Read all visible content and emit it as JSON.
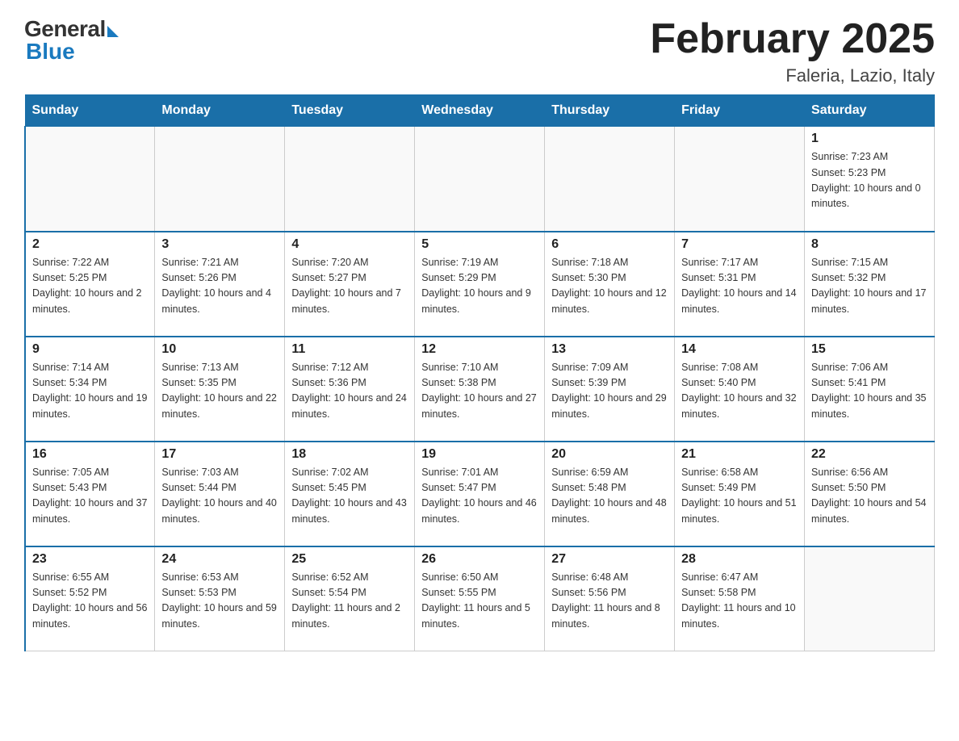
{
  "logo": {
    "general": "General",
    "blue": "Blue"
  },
  "header": {
    "title": "February 2025",
    "location": "Faleria, Lazio, Italy"
  },
  "weekdays": [
    "Sunday",
    "Monday",
    "Tuesday",
    "Wednesday",
    "Thursday",
    "Friday",
    "Saturday"
  ],
  "weeks": [
    [
      {
        "day": "",
        "info": ""
      },
      {
        "day": "",
        "info": ""
      },
      {
        "day": "",
        "info": ""
      },
      {
        "day": "",
        "info": ""
      },
      {
        "day": "",
        "info": ""
      },
      {
        "day": "",
        "info": ""
      },
      {
        "day": "1",
        "info": "Sunrise: 7:23 AM\nSunset: 5:23 PM\nDaylight: 10 hours and 0 minutes."
      }
    ],
    [
      {
        "day": "2",
        "info": "Sunrise: 7:22 AM\nSunset: 5:25 PM\nDaylight: 10 hours and 2 minutes."
      },
      {
        "day": "3",
        "info": "Sunrise: 7:21 AM\nSunset: 5:26 PM\nDaylight: 10 hours and 4 minutes."
      },
      {
        "day": "4",
        "info": "Sunrise: 7:20 AM\nSunset: 5:27 PM\nDaylight: 10 hours and 7 minutes."
      },
      {
        "day": "5",
        "info": "Sunrise: 7:19 AM\nSunset: 5:29 PM\nDaylight: 10 hours and 9 minutes."
      },
      {
        "day": "6",
        "info": "Sunrise: 7:18 AM\nSunset: 5:30 PM\nDaylight: 10 hours and 12 minutes."
      },
      {
        "day": "7",
        "info": "Sunrise: 7:17 AM\nSunset: 5:31 PM\nDaylight: 10 hours and 14 minutes."
      },
      {
        "day": "8",
        "info": "Sunrise: 7:15 AM\nSunset: 5:32 PM\nDaylight: 10 hours and 17 minutes."
      }
    ],
    [
      {
        "day": "9",
        "info": "Sunrise: 7:14 AM\nSunset: 5:34 PM\nDaylight: 10 hours and 19 minutes."
      },
      {
        "day": "10",
        "info": "Sunrise: 7:13 AM\nSunset: 5:35 PM\nDaylight: 10 hours and 22 minutes."
      },
      {
        "day": "11",
        "info": "Sunrise: 7:12 AM\nSunset: 5:36 PM\nDaylight: 10 hours and 24 minutes."
      },
      {
        "day": "12",
        "info": "Sunrise: 7:10 AM\nSunset: 5:38 PM\nDaylight: 10 hours and 27 minutes."
      },
      {
        "day": "13",
        "info": "Sunrise: 7:09 AM\nSunset: 5:39 PM\nDaylight: 10 hours and 29 minutes."
      },
      {
        "day": "14",
        "info": "Sunrise: 7:08 AM\nSunset: 5:40 PM\nDaylight: 10 hours and 32 minutes."
      },
      {
        "day": "15",
        "info": "Sunrise: 7:06 AM\nSunset: 5:41 PM\nDaylight: 10 hours and 35 minutes."
      }
    ],
    [
      {
        "day": "16",
        "info": "Sunrise: 7:05 AM\nSunset: 5:43 PM\nDaylight: 10 hours and 37 minutes."
      },
      {
        "day": "17",
        "info": "Sunrise: 7:03 AM\nSunset: 5:44 PM\nDaylight: 10 hours and 40 minutes."
      },
      {
        "day": "18",
        "info": "Sunrise: 7:02 AM\nSunset: 5:45 PM\nDaylight: 10 hours and 43 minutes."
      },
      {
        "day": "19",
        "info": "Sunrise: 7:01 AM\nSunset: 5:47 PM\nDaylight: 10 hours and 46 minutes."
      },
      {
        "day": "20",
        "info": "Sunrise: 6:59 AM\nSunset: 5:48 PM\nDaylight: 10 hours and 48 minutes."
      },
      {
        "day": "21",
        "info": "Sunrise: 6:58 AM\nSunset: 5:49 PM\nDaylight: 10 hours and 51 minutes."
      },
      {
        "day": "22",
        "info": "Sunrise: 6:56 AM\nSunset: 5:50 PM\nDaylight: 10 hours and 54 minutes."
      }
    ],
    [
      {
        "day": "23",
        "info": "Sunrise: 6:55 AM\nSunset: 5:52 PM\nDaylight: 10 hours and 56 minutes."
      },
      {
        "day": "24",
        "info": "Sunrise: 6:53 AM\nSunset: 5:53 PM\nDaylight: 10 hours and 59 minutes."
      },
      {
        "day": "25",
        "info": "Sunrise: 6:52 AM\nSunset: 5:54 PM\nDaylight: 11 hours and 2 minutes."
      },
      {
        "day": "26",
        "info": "Sunrise: 6:50 AM\nSunset: 5:55 PM\nDaylight: 11 hours and 5 minutes."
      },
      {
        "day": "27",
        "info": "Sunrise: 6:48 AM\nSunset: 5:56 PM\nDaylight: 11 hours and 8 minutes."
      },
      {
        "day": "28",
        "info": "Sunrise: 6:47 AM\nSunset: 5:58 PM\nDaylight: 11 hours and 10 minutes."
      },
      {
        "day": "",
        "info": ""
      }
    ]
  ]
}
